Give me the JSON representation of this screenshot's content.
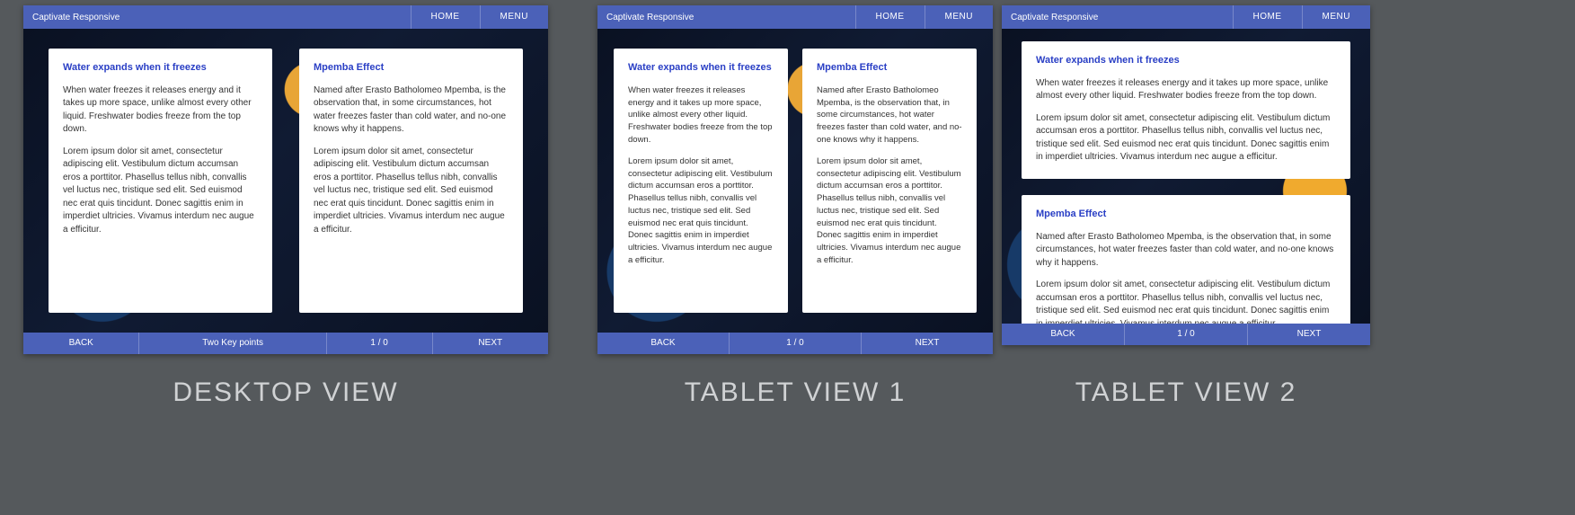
{
  "nav": {
    "title": "Captivate Responsive",
    "home": "HOME",
    "menu": "MENU"
  },
  "cards": {
    "water": {
      "title": "Water expands when it freezes",
      "p1": "When water freezes it releases energy and it takes up more space,  unlike almost every other liquid. Freshwater bodies freeze from the top down.",
      "p2": "Lorem ipsum dolor sit amet, consectetur adipiscing elit. Vestibulum dictum accumsan eros a porttitor. Phasellus tellus nibh, convallis vel luctus nec, tristique sed elit. Sed euismod nec erat quis tincidunt. Donec sagittis enim in imperdiet ultricies. Vivamus interdum nec augue a efficitur."
    },
    "mpemba": {
      "title": "Mpemba Effect",
      "p1": "Named after Erasto Batholomeo Mpemba, is the observation that, in some circumstances, hot water freezes faster than cold water, and no-one knows why it happens.",
      "p2": "Lorem ipsum dolor sit amet, consectetur adipiscing elit. Vestibulum dictum accumsan eros a porttitor. Phasellus tellus nibh, convallis vel luctus nec, tristique sed elit. Sed euismod nec erat quis tincidunt. Donec sagittis enim in imperdiet ultricies. Vivamus interdum nec augue a efficitur."
    }
  },
  "footer": {
    "back": "BACK",
    "next": "NEXT",
    "page": "1 / 0",
    "desktop_label": "Two Key points"
  },
  "captions": {
    "desktop": "DESKTOP VIEW",
    "tablet1": "TABLET VIEW 1",
    "tablet2": "TABLET VIEW 2"
  }
}
